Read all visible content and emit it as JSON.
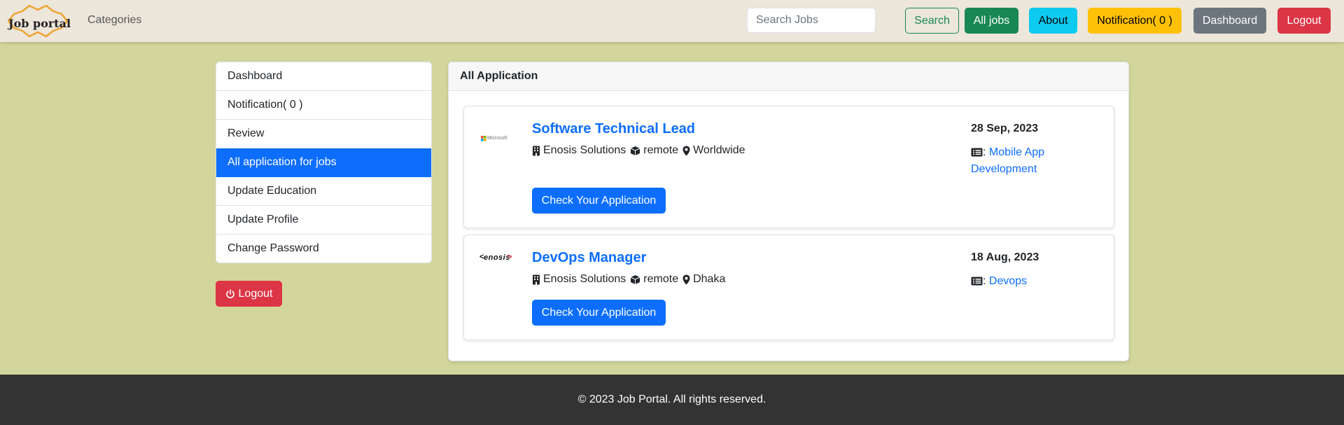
{
  "navbar": {
    "brand": "Job portal",
    "categories_link": "Categories",
    "search_placeholder": "Search Jobs",
    "search_button": "Search",
    "all_jobs_button": "All jobs",
    "about_button": "About",
    "notification_button": "Notification( 0 )",
    "dashboard_button": "Dashboard",
    "logout_button": "Logout",
    "colors": {
      "navbar_bg": "#ece6db",
      "green": "#198754",
      "cyan": "#0dcaf0",
      "yellow": "#ffc107",
      "gray": "#6c757d",
      "red": "#dc3545"
    }
  },
  "sidebar": {
    "items": [
      {
        "label": "Dashboard",
        "active": false
      },
      {
        "label": "Notification( 0 )",
        "active": false
      },
      {
        "label": "Review",
        "active": false
      },
      {
        "label": "All application for jobs",
        "active": true
      },
      {
        "label": "Update Education",
        "active": false
      },
      {
        "label": "Update Profile",
        "active": false
      },
      {
        "label": "Change Password",
        "active": false
      }
    ],
    "logout_button": "Logout",
    "logout_icon": "power-icon"
  },
  "main": {
    "header": "All Application",
    "applications": [
      {
        "logo_text": "Microsoft",
        "title": "Software Technical Lead",
        "company": "Enosis Solutions",
        "job_type": "remote",
        "location": "Worldwide",
        "button": "Check Your Application",
        "date": "28 Sep, 2023",
        "category": "Mobile App Development"
      },
      {
        "logo_text": "enosis",
        "title": "DevOps Manager",
        "company": "Enosis Solutions",
        "job_type": "remote",
        "location": "Dhaka",
        "button": "Check Your Application",
        "date": "18 Aug, 2023",
        "category": "Devops"
      }
    ],
    "category_separator": ":"
  },
  "footer": {
    "text": "© 2023 Job Portal. All rights reserved."
  },
  "theme": {
    "page_bg": "#d3d69c",
    "primary": "#0d6efd",
    "footer_bg": "#333333"
  }
}
